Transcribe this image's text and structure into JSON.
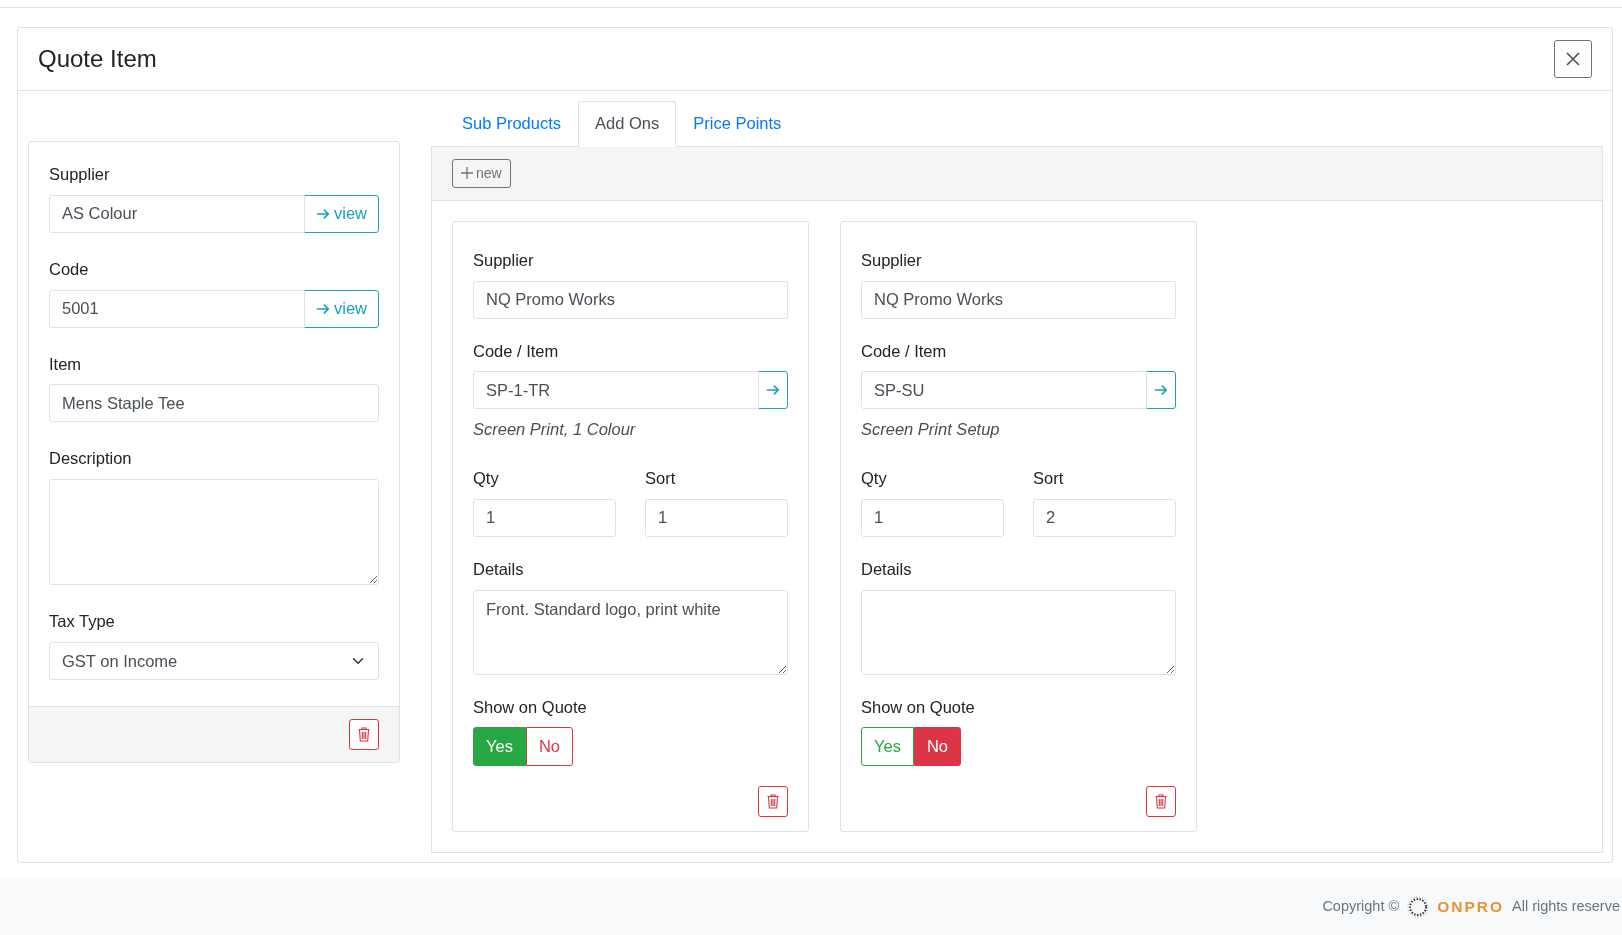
{
  "header": {
    "title": "Quote Item"
  },
  "item": {
    "fields": [
      {
        "kind": "link",
        "label": "Supplier",
        "value": "AS Colour",
        "button": "view"
      },
      {
        "kind": "link",
        "label": "Code",
        "value": "5001",
        "button": "view"
      },
      {
        "kind": "text",
        "label": "Item",
        "value": "Mens Staple Tee"
      },
      {
        "kind": "textarea",
        "label": "Description"
      },
      {
        "kind": "select",
        "label": "Tax Type",
        "value": "GST on Income"
      }
    ]
  },
  "tabs": [
    {
      "label": "Sub Products",
      "selected": false
    },
    {
      "label": "Add Ons",
      "selected": true
    },
    {
      "label": "Price Points",
      "selected": false
    }
  ],
  "new_button": "new",
  "addons": [
    {
      "supplier_label": "Supplier",
      "supplier": "NQ Promo Works",
      "code_label": "Code / Item",
      "code": "SP-1-TR",
      "description": "Screen Print, 1 Colour",
      "qty_label": "Qty",
      "qty": "1",
      "sort_label": "Sort",
      "sort": "1",
      "details_label": "Details",
      "details": "Front. Standard logo, print white",
      "show_label": "Show on Quote",
      "options": [
        {
          "label": "Yes",
          "kind": "positive",
          "selected": true
        },
        {
          "label": "No",
          "kind": "negative",
          "selected": false
        }
      ]
    },
    {
      "supplier_label": "Supplier",
      "supplier": "NQ Promo Works",
      "code_label": "Code / Item",
      "code": "SP-SU",
      "description": "Screen Print Setup",
      "qty_label": "Qty",
      "qty": "1",
      "sort_label": "Sort",
      "sort": "2",
      "details_label": "Details",
      "show_label": "Show on Quote",
      "options": [
        {
          "label": "Yes",
          "kind": "positive",
          "selected": false
        },
        {
          "label": "No",
          "kind": "negative",
          "selected": true
        }
      ]
    }
  ],
  "footer": {
    "copyright": "Copyright ©",
    "brand": "ONPRO",
    "rights": "All rights reserve"
  }
}
